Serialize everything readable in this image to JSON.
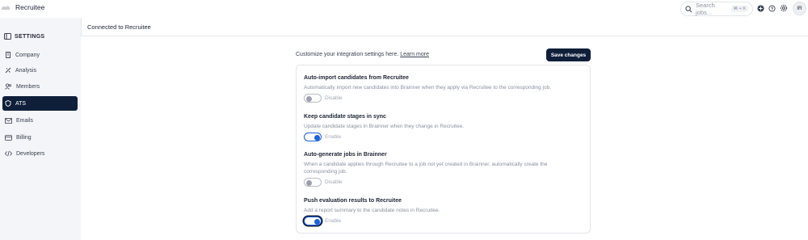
{
  "app": {
    "name": "Recruitee"
  },
  "search": {
    "placeholder": "Search jobs...",
    "shortcut": "⌘ + K"
  },
  "user": {
    "initials": "IR"
  },
  "sidebar": {
    "heading": "SETTINGS",
    "items": [
      {
        "label": "Company",
        "icon": "building-icon"
      },
      {
        "label": "Analysis",
        "icon": "analysis-icon"
      },
      {
        "label": "Members",
        "icon": "members-icon"
      },
      {
        "label": "ATS",
        "icon": "shield-icon",
        "active": true
      },
      {
        "label": "Emails",
        "icon": "mail-icon"
      },
      {
        "label": "Billing",
        "icon": "card-icon"
      },
      {
        "label": "Developers",
        "icon": "code-icon"
      }
    ]
  },
  "page": {
    "title": "Connected to Recruitee",
    "intro": "Customize your integration settings here.",
    "learn_more": "Learn more",
    "save_label": "Save changes"
  },
  "settings": [
    {
      "title": "Auto-import candidates from Recruitee",
      "description": "Automatically import new candidates into Brainner when they apply via Recruitee to the corresponding job.",
      "enabled": false,
      "state_label": "Disable"
    },
    {
      "title": "Keep candidate stages in sync",
      "description": "Update candidate stages in Brainner when they change in Recruitee.",
      "enabled": true,
      "state_label": "Enable"
    },
    {
      "title": "Auto-generate jobs in Brainner",
      "description": "When a candidate applies through Recruitee to a job not yet created in Brainner, automatically create the corresponding job.",
      "enabled": false,
      "state_label": "Disable"
    },
    {
      "title": "Push evaluation results to Recruitee",
      "description": "Add a report summary to the candidate notes in Recruitee.",
      "enabled": true,
      "state_label": "Enable"
    }
  ],
  "colors": {
    "primary": "#0f1f3a",
    "accent": "#1c5fd8",
    "sidebar_bg": "#f4f5f8"
  }
}
